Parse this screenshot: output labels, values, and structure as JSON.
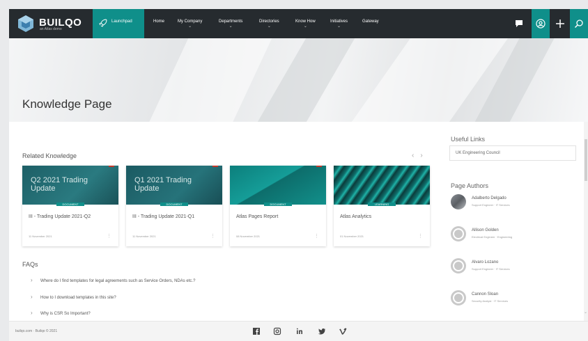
{
  "brand": {
    "name": "BUILQO",
    "tagline": "an Atlas demo"
  },
  "nav": {
    "launchpad": "Launchpad",
    "items": [
      {
        "label": "Home",
        "chevron": false
      },
      {
        "label": "My Company",
        "chevron": true
      },
      {
        "label": "Departments",
        "chevron": true
      },
      {
        "label": "Directories",
        "chevron": true
      },
      {
        "label": "Know How",
        "chevron": true
      },
      {
        "label": "Initiatives",
        "chevron": true
      },
      {
        "label": "Gateway",
        "chevron": false
      }
    ]
  },
  "page": {
    "title": "Knowledge Page"
  },
  "related": {
    "title": "Related Knowledge",
    "cards": [
      {
        "image_title": [
          "Q2 2021 Trading",
          "Update"
        ],
        "tag": "DOCUMENT",
        "title": "III - Trading Update 2021-Q2",
        "date": "11 November 2021"
      },
      {
        "image_title": [
          "Q1 2021 Trading",
          "Update"
        ],
        "tag": "DOCUMENT",
        "title": "III - Trading Update 2021-Q1",
        "date": "11 November 2021"
      },
      {
        "image_title": [],
        "tag": "DOCUMENT",
        "title": "Atlas Pages Report",
        "date": "08 November 2021"
      },
      {
        "image_title": [],
        "tag": "LEARNING",
        "title": "Atlas Analytics",
        "date": "01 November 2021"
      }
    ]
  },
  "faqs": {
    "title": "FAQs",
    "items": [
      "Where do I find templates for legal agreements such as Service Orders, NDAs etc.?",
      "How to I download templates in this site?",
      "Why is CSR So Important?"
    ]
  },
  "useful_links": {
    "title": "Useful Links",
    "items": [
      "UK Engineering Council"
    ]
  },
  "authors": {
    "title": "Page Authors",
    "items": [
      {
        "name": "Adalberto Delgado",
        "role": "Support Engineer · IT Services",
        "photo": true
      },
      {
        "name": "Allison Golden",
        "role": "Electrical Engineer · Engineering",
        "photo": false
      },
      {
        "name": "Alvaro Lozano",
        "role": "Support Engineer · IT Services",
        "photo": false
      },
      {
        "name": "Cannon Sloan",
        "role": "Security Analyst · IT Services",
        "photo": false
      }
    ]
  },
  "footer": {
    "copyright": "builqo.com · Builqo © 2021"
  },
  "colors": {
    "nav_bg": "#262b2f",
    "accent": "#0f8f8a"
  },
  "icons": [
    "rocket-icon",
    "chat-icon",
    "user-circle-icon",
    "plus-icon",
    "search-icon",
    "facebook-icon",
    "instagram-icon",
    "linkedin-icon",
    "twitter-icon",
    "vimeo-icon"
  ]
}
